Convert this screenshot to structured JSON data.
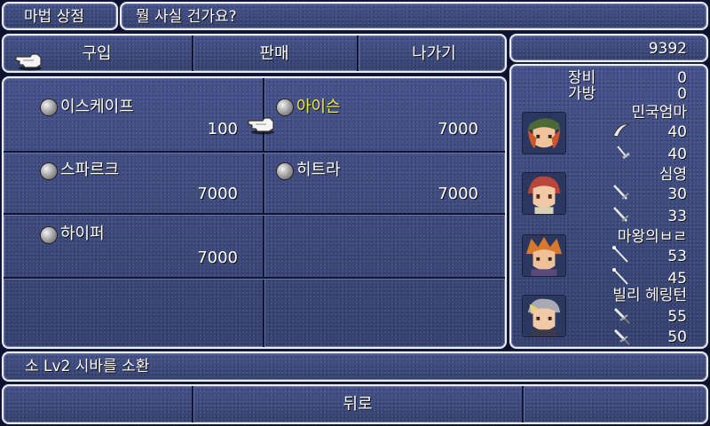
{
  "shop": {
    "title": "마법 상점",
    "prompt": "뭘 사실 건가요?"
  },
  "menu": {
    "buy": "구입",
    "sell": "판매",
    "exit": "나가기"
  },
  "gil": "9392",
  "spells": [
    {
      "name": "이스케이프",
      "price": "100",
      "selected": false
    },
    {
      "name": "아이슨",
      "price": "7000",
      "selected": true
    },
    {
      "name": "스파르크",
      "price": "7000",
      "selected": false
    },
    {
      "name": "히트라",
      "price": "7000",
      "selected": false
    },
    {
      "name": "하이퍼",
      "price": "7000",
      "selected": false
    }
  ],
  "equip_info": {
    "equip_label": "장비",
    "equip_value": "0",
    "bag_label": "가방",
    "bag_value": "0"
  },
  "party": [
    {
      "name": "민국엄마",
      "stat1": "40",
      "stat2": "40",
      "icon1": "boomerang-icon",
      "icon2": "dagger-icon"
    },
    {
      "name": "심영",
      "stat1": "30",
      "stat2": "33",
      "icon1": "sword-icon",
      "icon2": "sword-icon"
    },
    {
      "name": "마왕의ㅂㄹ",
      "stat1": "53",
      "stat2": "45",
      "icon1": "rod-icon",
      "icon2": "rod-icon"
    },
    {
      "name": "빌리 헤링턴",
      "stat1": "55",
      "stat2": "50",
      "icon1": "knife-icon",
      "icon2": "knife-icon"
    }
  ],
  "description": "소 Lv2 시바를 소환",
  "back_label": "뒤로",
  "colors": {
    "panel": "#3a4778",
    "border": "#e9ecf4",
    "selected_text": "#f2e84a"
  }
}
